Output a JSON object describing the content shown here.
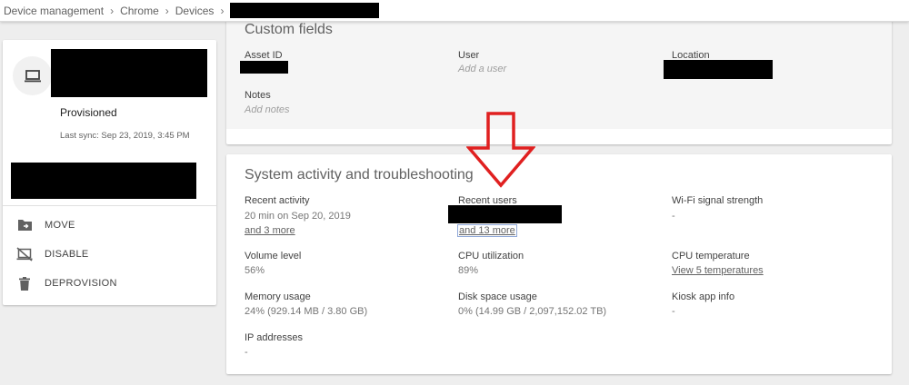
{
  "breadcrumb": {
    "items": [
      "Device management",
      "Chrome",
      "Devices"
    ],
    "separator": "›"
  },
  "device": {
    "icon": "laptop-icon",
    "status": "Provisioned",
    "last_sync": "Last sync: Sep 23, 2019, 3:45 PM"
  },
  "actions": [
    {
      "label": "MOVE",
      "icon": "move-to-folder-icon"
    },
    {
      "label": "DISABLE",
      "icon": "disable-device-icon"
    },
    {
      "label": "DEPROVISION",
      "icon": "trash-icon"
    }
  ],
  "custom_fields": {
    "title": "Custom fields",
    "asset_id_label": "Asset ID",
    "user_label": "User",
    "user_placeholder": "Add a user",
    "location_label": "Location",
    "notes_label": "Notes",
    "notes_placeholder": "Add notes"
  },
  "system": {
    "title": "System activity and troubleshooting",
    "recent_activity_label": "Recent activity",
    "recent_activity_value": "20 min on Sep 20, 2019",
    "recent_activity_more": "and 3 more",
    "recent_users_label": "Recent users",
    "recent_users_more": "and 13 more",
    "wifi_label": "Wi-Fi signal strength",
    "wifi_value": "-",
    "volume_label": "Volume level",
    "volume_value": "56%",
    "cpu_util_label": "CPU utilization",
    "cpu_util_value": "89%",
    "cpu_temp_label": "CPU temperature",
    "cpu_temp_link": "View 5 temperatures",
    "memory_label": "Memory usage",
    "memory_value": "24% (929.14 MB / 3.80 GB)",
    "disk_label": "Disk space usage",
    "disk_value": "0% (14.99 GB / 2,097,152.02 TB)",
    "kiosk_label": "Kiosk app info",
    "kiosk_value": "-",
    "ip_label": "IP addresses",
    "ip_value": "-"
  },
  "colors": {
    "arrow": "#e02020",
    "redaction": "#000000",
    "background": "#eeeeee"
  }
}
